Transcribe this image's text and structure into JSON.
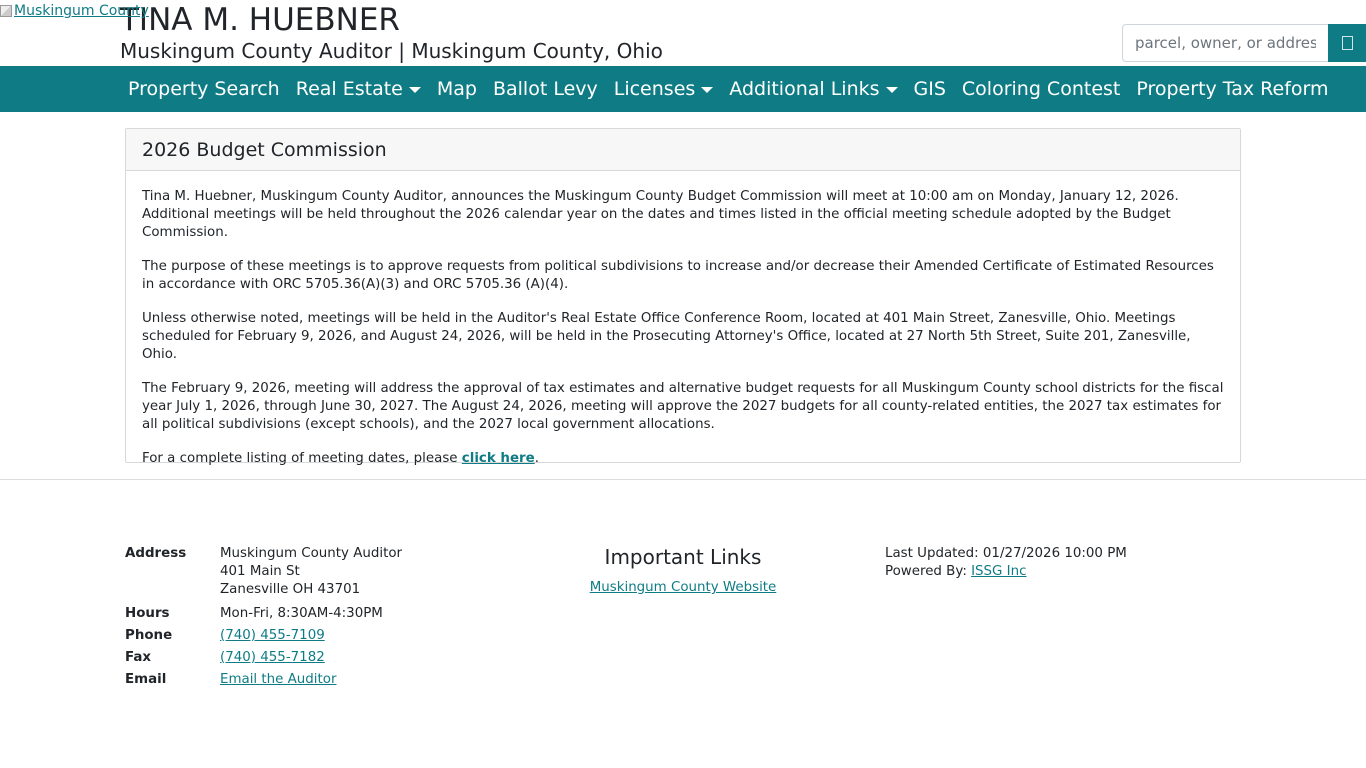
{
  "header": {
    "logo_alt": "Muskingum County",
    "title": "TINA M. HUEBNER",
    "subtitle": "Muskingum County Auditor | Muskingum County, Ohio",
    "search_placeholder": "parcel, owner, or address",
    "search_icon": "search-icon"
  },
  "nav": {
    "items": [
      {
        "label": "Property Search",
        "dropdown": false
      },
      {
        "label": "Real Estate",
        "dropdown": true
      },
      {
        "label": "Map",
        "dropdown": false
      },
      {
        "label": "Ballot Levy",
        "dropdown": false
      },
      {
        "label": "Licenses",
        "dropdown": true
      },
      {
        "label": "Additional Links",
        "dropdown": true
      },
      {
        "label": "GIS",
        "dropdown": false
      },
      {
        "label": "Coloring Contest",
        "dropdown": false
      },
      {
        "label": "Property Tax Reform",
        "dropdown": false
      }
    ]
  },
  "main": {
    "card_title": "2026 Budget Commission",
    "paragraphs": [
      "Tina M. Huebner, Muskingum County Auditor, announces the Muskingum County Budget Commission will meet at 10:00 am on Monday, January 12, 2026. Additional meetings will be held throughout the 2026 calendar year on the dates and times listed in the official meeting schedule adopted by the Budget Commission.",
      "The purpose of these meetings is to approve requests from political subdivisions to increase and/or decrease their Amended Certificate of Estimated Resources in accordance with ORC 5705.36(A)(3) and ORC 5705.36 (A)(4).",
      "Unless otherwise noted, meetings will be held in the Auditor's Real Estate Office Conference Room, located at 401 Main Street, Zanesville, Ohio. Meetings scheduled for February 9, 2026, and August 24, 2026, will be held in the Prosecuting Attorney's Office, located at 27 North 5th Street, Suite 201, Zanesville, Ohio.",
      "The February 9, 2026, meeting will address the approval of tax estimates and alternative budget requests for all Muskingum County school districts for the fiscal year July 1, 2026, through June 30, 2027. The August 24, 2026, meeting will approve the 2027 budgets for all county-related entities, the 2027 tax estimates for all political subdivisions (except schools), and the 2027 local government allocations."
    ],
    "listing_prefix": "For a complete listing of meeting dates, please ",
    "listing_link": "click here",
    "listing_suffix": "."
  },
  "footer": {
    "address_label": "Address",
    "address_lines": [
      "Muskingum County Auditor",
      "401 Main St",
      "Zanesville OH 43701"
    ],
    "hours_label": "Hours",
    "hours_value": "Mon-Fri, 8:30AM-4:30PM",
    "phone_label": "Phone",
    "phone_value": "(740) 455-7109",
    "fax_label": "Fax",
    "fax_value": "(740) 455-7182",
    "email_label": "Email",
    "email_value": "Email the Auditor",
    "important_title": "Important Links",
    "important_link": "Muskingum County Website",
    "last_updated": "Last Updated: 01/27/2026 10:00 PM",
    "powered_prefix": "Powered By: ",
    "powered_link": "ISSG Inc"
  },
  "colors": {
    "brand_teal": "#0f7c85",
    "card_header_bg": "#f7f7f7"
  }
}
